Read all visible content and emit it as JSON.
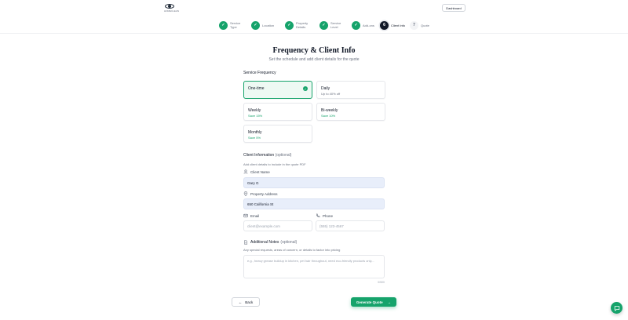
{
  "header": {
    "logo_text": "HOMECLEAN",
    "dashboard_label": "Dashboard"
  },
  "stepper": {
    "steps": [
      {
        "number": "1",
        "label": "Service Type",
        "state": "done"
      },
      {
        "number": "2",
        "label": "Location",
        "state": "done"
      },
      {
        "number": "3",
        "label": "Property Details",
        "state": "done"
      },
      {
        "number": "4",
        "label": "Service Level",
        "state": "done"
      },
      {
        "number": "5",
        "label": "Add-ons",
        "state": "done"
      },
      {
        "number": "6",
        "label": "Client Info",
        "state": "active"
      },
      {
        "number": "7",
        "label": "Quote",
        "state": "todo"
      }
    ]
  },
  "page": {
    "title": "Frequency & Client Info",
    "subtitle": "Set the schedule and add client details for the quote"
  },
  "frequency": {
    "label": "Service Frequency",
    "options": [
      {
        "name": "One-time",
        "note": "",
        "selected": true
      },
      {
        "name": "Daily",
        "note": "Up to 40% off",
        "selected": false
      },
      {
        "name": "Weekly",
        "note": "Save 15%",
        "selected": false
      },
      {
        "name": "Bi-weekly",
        "note": "Save 10%",
        "selected": false
      },
      {
        "name": "Monthly",
        "note": "Save 5%",
        "selected": false
      }
    ]
  },
  "client": {
    "label": "Client Information",
    "optional": "(optional)",
    "helper": "Add client details to include in the quote PDF",
    "name_label": "Client Name",
    "name_value": "Gary G",
    "address_label": "Property Address",
    "address_value": "650 California St",
    "email_label": "Email",
    "email_placeholder": "client@example.com",
    "phone_label": "Phone",
    "phone_placeholder": "(555) 123-4567"
  },
  "notes": {
    "label": "Additional Notes",
    "optional": "(optional)",
    "helper": "Any special requests, areas of concern, or details to factor into pricing",
    "placeholder": "e.g., heavy grease buildup in kitchen, pet hair throughout, need eco-friendly products only...",
    "counter": "0/500"
  },
  "actions": {
    "back_label": "Back",
    "generate_label": "Generate Quote"
  },
  "colors": {
    "accent": "#16a36b",
    "selected_bg": "#eef9f3",
    "filled_input_bg": "#e8eefa"
  }
}
